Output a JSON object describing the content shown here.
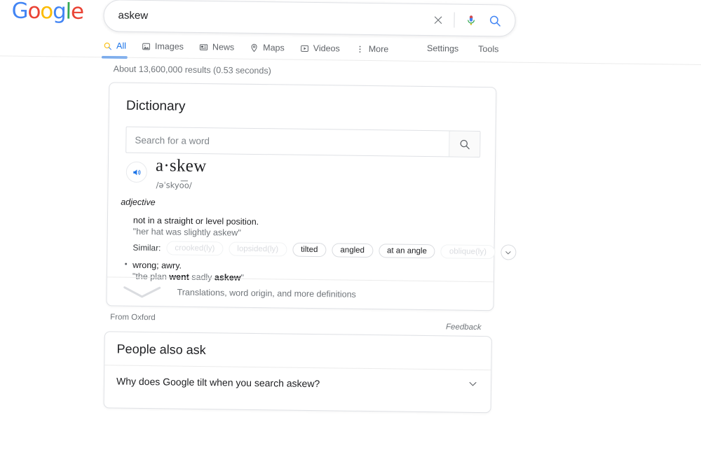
{
  "header": {
    "logo": {
      "letters": [
        "G",
        "o",
        "o",
        "g",
        "l",
        "e"
      ]
    },
    "search": {
      "query": "askew",
      "clear_icon": "close-icon",
      "mic_icon": "microphone-icon",
      "search_icon": "search-icon"
    }
  },
  "nav": {
    "tabs": [
      {
        "label": "All",
        "icon": "search-icon",
        "active": true
      },
      {
        "label": "Images",
        "icon": "image-icon",
        "active": false
      },
      {
        "label": "News",
        "icon": "news-icon",
        "active": false
      },
      {
        "label": "Maps",
        "icon": "map-pin-icon",
        "active": false
      },
      {
        "label": "Videos",
        "icon": "video-icon",
        "active": false
      },
      {
        "label": "More",
        "icon": "overflow-dots-icon",
        "active": false
      }
    ],
    "settings_label": "Settings",
    "tools_label": "Tools"
  },
  "results": {
    "count_text": "About 13,600,000 results (0.53 seconds)"
  },
  "dictionary": {
    "title": "Dictionary",
    "word_search_placeholder": "Search for a word",
    "word_search_value": "",
    "speaker_icon": "speaker-icon",
    "headword": "a·skew",
    "phonetic": "/əˈskyo͞o/",
    "part_of_speech": "adjective",
    "senses": [
      {
        "definition": "not in a straight or level position.",
        "example": "\"her hat was slightly askew\""
      }
    ],
    "similar": {
      "label": "Similar:",
      "chips": [
        {
          "text": "crooked(ly)",
          "faded": true
        },
        {
          "text": "lopsided(ly)",
          "faded": true
        },
        {
          "text": "tilted",
          "faded": false
        },
        {
          "text": "angled",
          "faded": false
        },
        {
          "text": "at an angle",
          "faded": false
        },
        {
          "text": "oblique(ly)",
          "faded": true
        }
      ],
      "more_icon": "chevron-down-icon"
    },
    "sense2": {
      "definition": "wrong; awry.",
      "example_prefix": "\"the plan ",
      "example_bold1": "went",
      "example_middle": " sadly ",
      "example_bold2": "askew",
      "example_suffix": "\""
    },
    "translations_label": "Translations, word origin, and more definitions",
    "translations_icon": "chevron-down-icon",
    "source": "From Oxford",
    "feedback": "Feedback"
  },
  "people_also_ask": {
    "title": "People also ask",
    "questions": [
      {
        "text": "Why does Google tilt when you search askew?",
        "icon": "chevron-down-icon"
      }
    ]
  },
  "colors": {
    "google_blue": "#4285F4",
    "google_red": "#EA4335",
    "google_yellow": "#FBBC05",
    "google_green": "#34A853",
    "active_tab": "#1a73e8",
    "text_primary": "#202124",
    "text_secondary": "#70757a"
  }
}
